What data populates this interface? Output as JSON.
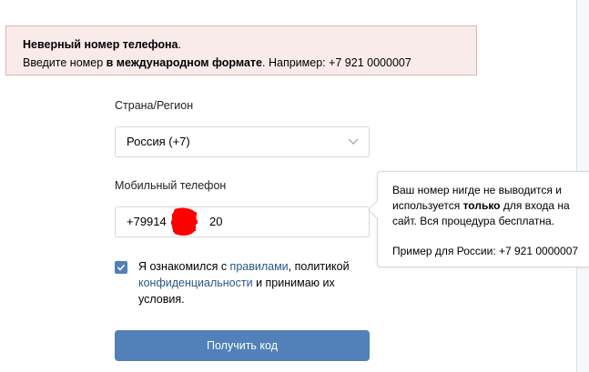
{
  "error": {
    "title": "Неверный номер телефона",
    "title_end": ".",
    "line2_prefix": "Введите номер ",
    "line2_bold": "в международном формате",
    "line2_suffix": ". Например: +7 921 0000007"
  },
  "country": {
    "label": "Страна/Регион",
    "selected": "Россия (+7)"
  },
  "phone": {
    "label": "Мобильный телефон",
    "value_prefix": "+79914",
    "value_suffix": "20"
  },
  "tooltip": {
    "text_part1": "Ваш номер нигде не выводится и используется ",
    "text_bold": "только",
    "text_part2": " для входа на сайт. Вся процедура бесплатна.",
    "example": "Пример для России: +7 921 0000007"
  },
  "agreement": {
    "checked": true,
    "part1": "Я ознакомился с ",
    "rules_link": "правилами",
    "part2": ", политикой ",
    "privacy_link": "конфиденциальности",
    "part3": " и принимаю их условия."
  },
  "submit": {
    "label": "Получить код"
  },
  "colors": {
    "accent": "#5181b8",
    "link": "#2a5885",
    "error_bg": "#faebeb",
    "error_border": "#e3b1b1",
    "redaction": "#ff0000"
  }
}
